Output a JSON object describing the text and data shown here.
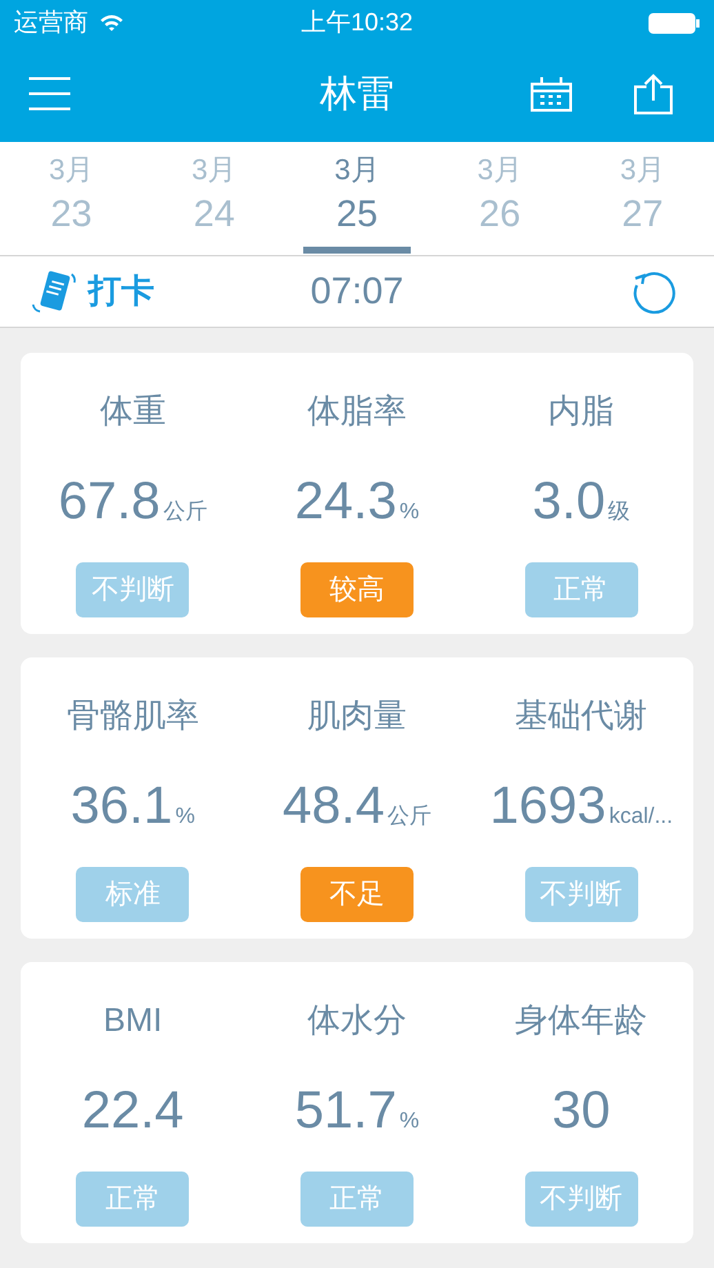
{
  "status_bar": {
    "carrier": "运营商",
    "time": "上午10:32"
  },
  "nav": {
    "title": "林雷"
  },
  "dates": [
    {
      "month": "3月",
      "day": "23",
      "selected": false
    },
    {
      "month": "3月",
      "day": "24",
      "selected": false
    },
    {
      "month": "3月",
      "day": "25",
      "selected": true
    },
    {
      "month": "3月",
      "day": "26",
      "selected": false
    },
    {
      "month": "3月",
      "day": "27",
      "selected": false
    }
  ],
  "checkin": {
    "label": "打卡",
    "time": "07:07"
  },
  "cards": [
    {
      "metrics": [
        {
          "label": "体重",
          "value": "67.8",
          "unit": "公斤",
          "status": "不判断",
          "kind": "normal"
        },
        {
          "label": "体脂率",
          "value": "24.3",
          "unit": "%",
          "status": "较高",
          "kind": "warning"
        },
        {
          "label": "内脂",
          "value": "3.0",
          "unit": "级",
          "status": "正常",
          "kind": "normal"
        }
      ]
    },
    {
      "metrics": [
        {
          "label": "骨骼肌率",
          "value": "36.1",
          "unit": "%",
          "status": "标准",
          "kind": "normal"
        },
        {
          "label": "肌肉量",
          "value": "48.4",
          "unit": "公斤",
          "status": "不足",
          "kind": "warning"
        },
        {
          "label": "基础代谢",
          "value": "1693",
          "unit": "kcal/...",
          "status": "不判断",
          "kind": "normal"
        }
      ]
    },
    {
      "metrics": [
        {
          "label": "BMI",
          "value": "22.4",
          "status": "正常",
          "kind": "normal"
        },
        {
          "label": "体水分",
          "value": "51.7",
          "unit": "%",
          "status": "正常",
          "kind": "normal"
        },
        {
          "label": "身体年龄",
          "value": "30",
          "status": "不判断",
          "kind": "normal"
        }
      ]
    }
  ]
}
